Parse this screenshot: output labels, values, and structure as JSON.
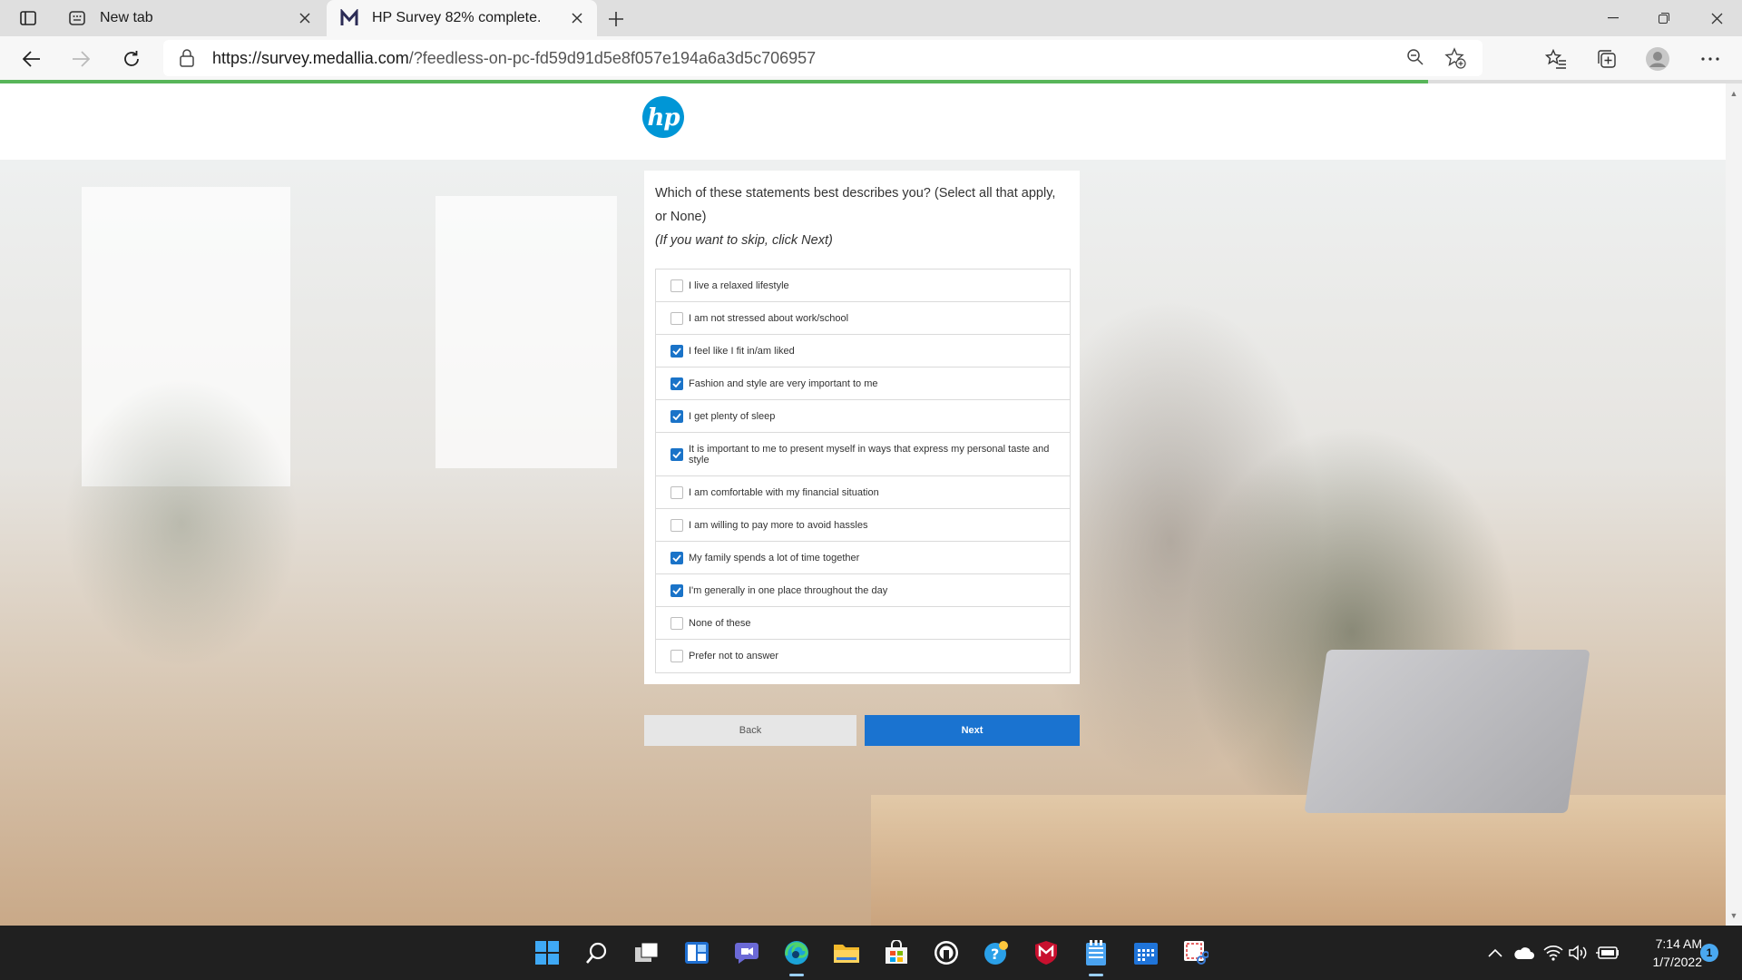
{
  "browser": {
    "tabs": [
      {
        "title": "New tab",
        "active": false
      },
      {
        "title": "HP Survey 82% complete.",
        "active": true
      }
    ],
    "url_host": "https://survey.medallia.com",
    "url_path": "/?feedless-on-pc-fd59d91d5e8f057e194a6a3d5c706957",
    "progress_fraction": 0.82
  },
  "survey": {
    "question": "Which of these statements best describes you? (Select all that apply, or None)",
    "hint": "(If you want to skip, click Next)",
    "options": [
      {
        "label": "I live a relaxed lifestyle",
        "checked": false
      },
      {
        "label": "I am not stressed about work/school",
        "checked": false
      },
      {
        "label": "I feel like I fit in/am liked",
        "checked": true
      },
      {
        "label": "Fashion and style are very important to me",
        "checked": true
      },
      {
        "label": "I get plenty of sleep",
        "checked": true
      },
      {
        "label": "It is important to me to present myself in ways that express my personal taste and style",
        "checked": true
      },
      {
        "label": "I am comfortable with my financial situation",
        "checked": false
      },
      {
        "label": "I am willing to pay more to avoid hassles",
        "checked": false
      },
      {
        "label": "My family spends a lot of time together",
        "checked": true
      },
      {
        "label": "I'm generally in one place throughout the day",
        "checked": true
      },
      {
        "label": "None of these",
        "checked": false
      },
      {
        "label": "Prefer not to answer",
        "checked": false
      }
    ],
    "back_label": "Back",
    "next_label": "Next"
  },
  "logo_text": "hp",
  "taskbar": {
    "time": "7:14 AM",
    "date": "1/7/2022",
    "notification_count": "1"
  },
  "colors": {
    "accent_blue": "#1a73d0",
    "progress_green": "#58b559",
    "hp_blue": "#0096d6"
  }
}
